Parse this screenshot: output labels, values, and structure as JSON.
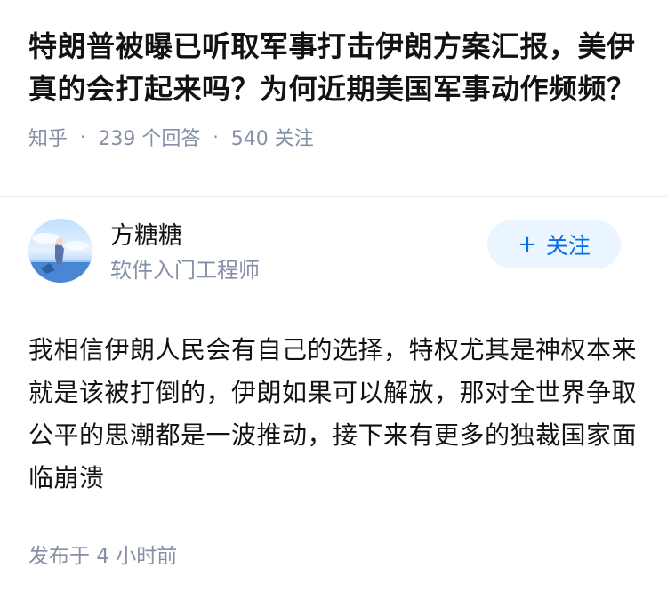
{
  "question": {
    "title": "特朗普被曝已听取军事打击伊朗方案汇报，美伊真的会打起来吗？为何近期美国军事动作频频？",
    "source": "知乎",
    "answers": "239 个回答",
    "follows": "540 关注"
  },
  "answer": {
    "author_name": "方糖糖",
    "author_title": "软件入门工程师",
    "follow_icon": "plus-icon",
    "follow_label": "关注",
    "content": "我相信伊朗人民会有自己的选择，特权尤其是神权本来就是该被打倒的，伊朗如果可以解放，那对全世界争取公平的思潮都是一波推动，接下来有更多的独裁国家面临崩溃",
    "published": "发布于 4 小时前"
  },
  "colors": {
    "accent": "#056de8",
    "accent_bg": "#ebf5ff",
    "meta": "#8590a6",
    "text": "#121212"
  }
}
